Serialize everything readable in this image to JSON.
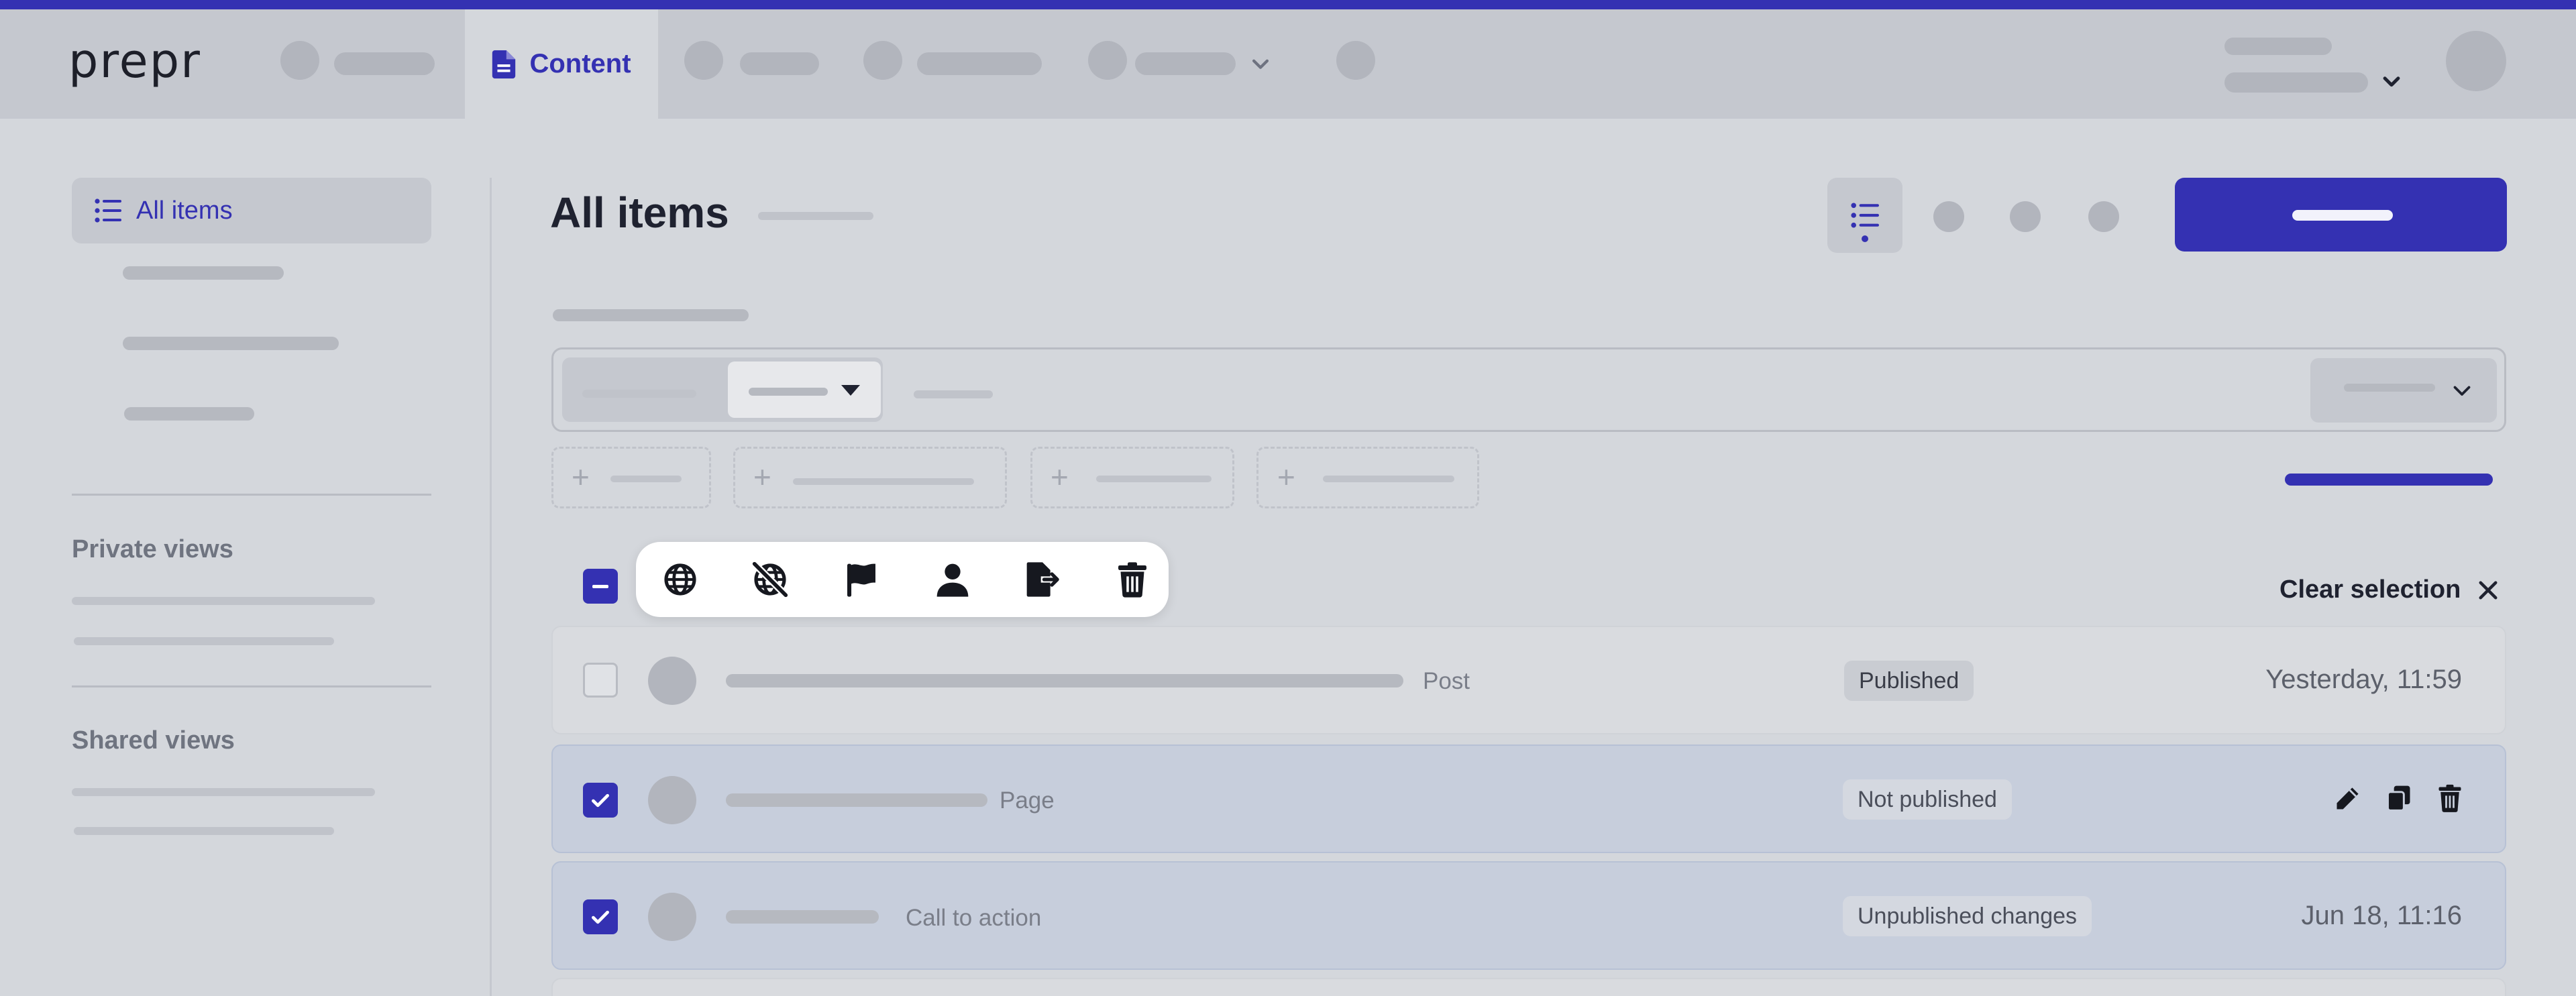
{
  "app": {
    "logo": "prepr"
  },
  "topnav": {
    "active_tab": "Content",
    "active_icon": "document-icon"
  },
  "sidebar": {
    "active_item": "All items",
    "active_icon": "list-icon",
    "sections": [
      {
        "title": "Private views"
      },
      {
        "title": "Shared views"
      }
    ]
  },
  "header": {
    "title": "All items",
    "view_icon": "list-icon"
  },
  "selection_toolbar": {
    "actions": [
      {
        "name": "globe-icon"
      },
      {
        "name": "unpublish-globe-icon"
      },
      {
        "name": "flag-icon"
      },
      {
        "name": "user-icon"
      },
      {
        "name": "export-icon"
      },
      {
        "name": "trash-icon"
      }
    ],
    "clear_label": "Clear selection"
  },
  "rows": [
    {
      "type": "Post",
      "status": "Published",
      "date": "Yesterday, 11:59",
      "selected": false
    },
    {
      "type": "Page",
      "status": "Not published",
      "date": "",
      "selected": true,
      "hovered": true
    },
    {
      "type": "Call to action",
      "status": "Unpublished changes",
      "date": "Jun 18, 11:16",
      "selected": true
    }
  ],
  "colors": {
    "accent": "#3431b2",
    "background": "#d4d7dc",
    "nav": "#c5c8cf",
    "selected_row": "#c7cedc"
  }
}
